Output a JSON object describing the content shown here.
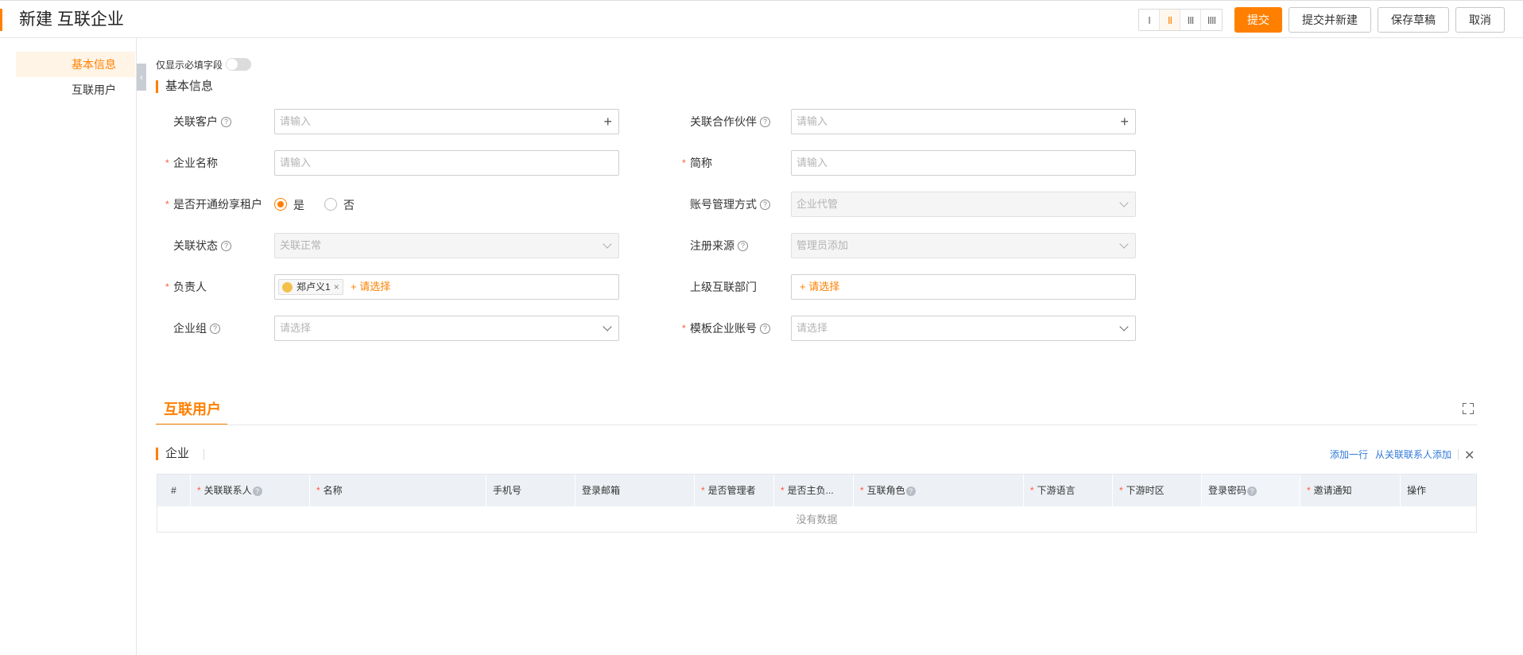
{
  "header": {
    "title": "新建 互联企业",
    "column_options": [
      "I",
      "II",
      "III",
      "IIII"
    ],
    "submit_label": "提交",
    "submit_new_label": "提交并新建",
    "save_draft_label": "保存草稿",
    "cancel_label": "取消"
  },
  "sidebar": {
    "items": [
      {
        "label": "基本信息",
        "active": true
      },
      {
        "label": "互联用户",
        "active": false
      }
    ]
  },
  "required_toggle_label": "仅显示必填字段",
  "section_basic": "基本信息",
  "form": {
    "related_customer": {
      "label": "关联客户",
      "placeholder": "请输入"
    },
    "related_partner": {
      "label": "关联合作伙伴",
      "placeholder": "请输入"
    },
    "company_name": {
      "label": "企业名称",
      "placeholder": "请输入"
    },
    "short_name": {
      "label": "简称",
      "placeholder": "请输入"
    },
    "share_tenant": {
      "label": "是否开通纷享租户",
      "yes": "是",
      "no": "否"
    },
    "account_mgmt": {
      "label": "账号管理方式",
      "value": "企业代管"
    },
    "relation_status": {
      "label": "关联状态",
      "value": "关联正常"
    },
    "register_source": {
      "label": "注册来源",
      "value": "管理员添加"
    },
    "owner": {
      "label": "负责人",
      "tag": "郑卢义1",
      "pick": "+ 请选择"
    },
    "parent_dept": {
      "label": "上级互联部门",
      "pick": "+ 请选择"
    },
    "company_group": {
      "label": "企业组",
      "placeholder": "请选择"
    },
    "template_account": {
      "label": "模板企业账号",
      "placeholder": "请选择"
    }
  },
  "tab": {
    "label": "互联用户"
  },
  "subsection": {
    "title": "企业",
    "add_row": "添加一行",
    "add_from_contacts": "从关联联系人添加"
  },
  "table": {
    "columns": [
      "#",
      "关联联系人",
      "名称",
      "手机号",
      "登录邮箱",
      "是否管理者",
      "是否主负...",
      "互联角色",
      "下游语言",
      "下游时区",
      "登录密码",
      "邀请通知",
      "操作"
    ],
    "empty_text": "没有数据"
  },
  "colors": {
    "accent": "#ff8000",
    "link": "#2f79d9",
    "required": "#ff5a36"
  }
}
